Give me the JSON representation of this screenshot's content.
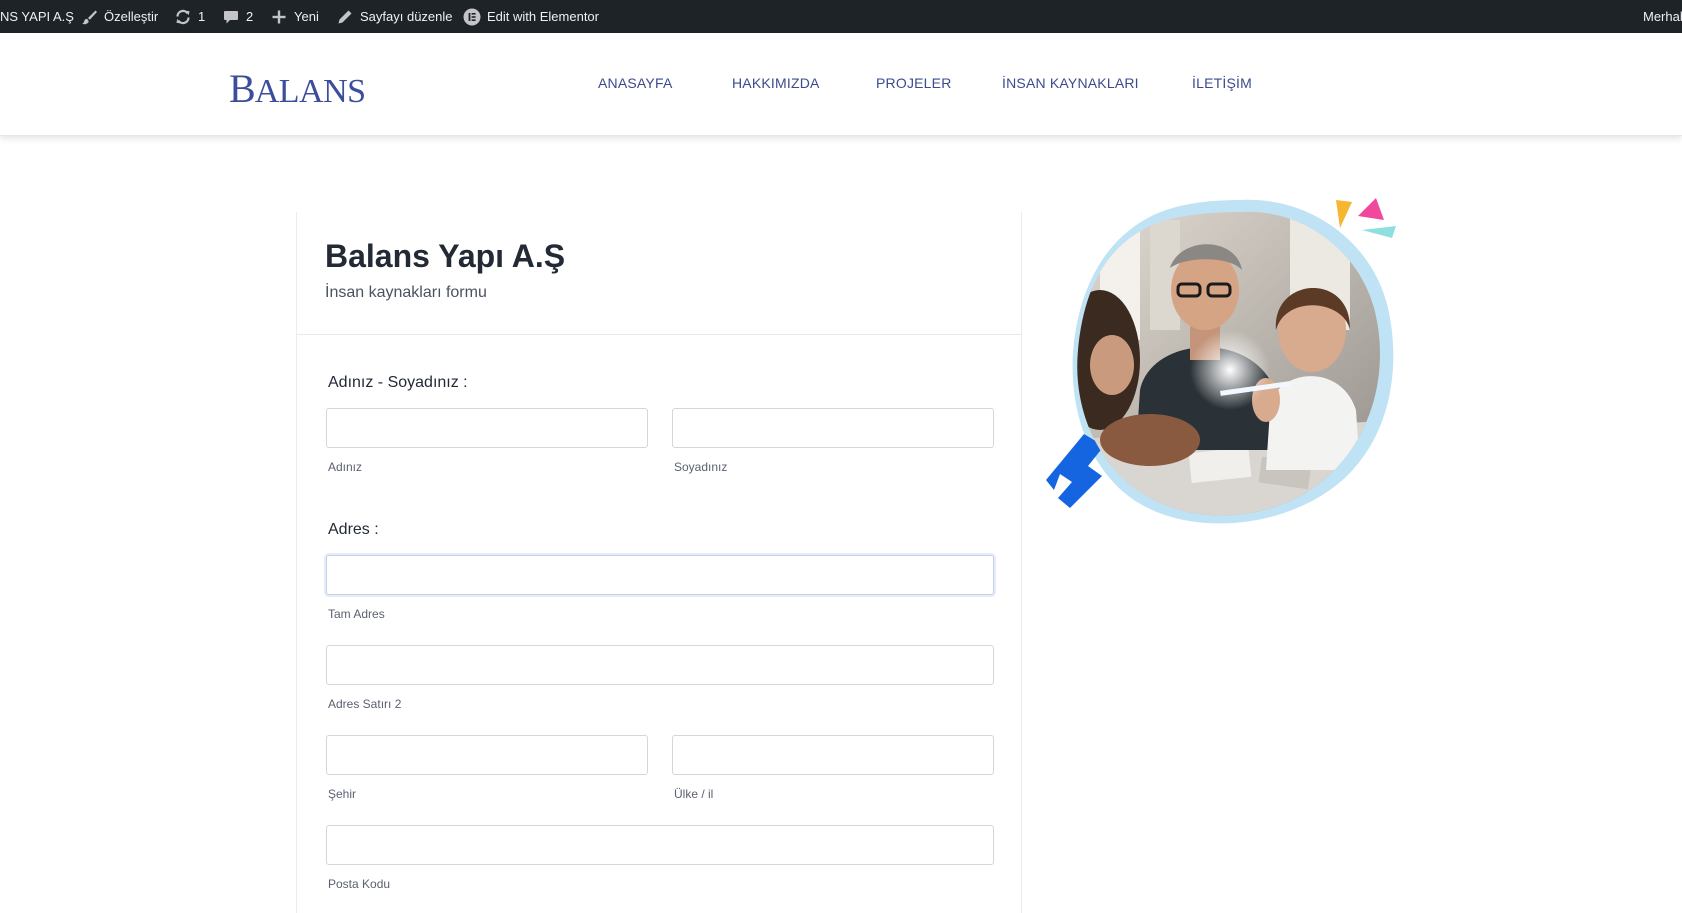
{
  "adminbar": {
    "site_name": "NS YAPI A.Ş",
    "customize": "Özelleştir",
    "updates_count": "1",
    "comments_count": "2",
    "new": "Yeni",
    "edit_page": "Sayfayı düzenle",
    "edit_elementor": "Edit with Elementor",
    "greeting": "Merhab"
  },
  "header": {
    "logo_initial": "B",
    "logo_rest": "ALANS",
    "nav": [
      {
        "label": "ANASAYFA"
      },
      {
        "label": "HAKKIMIZDA"
      },
      {
        "label": "PROJELER"
      },
      {
        "label": "İNSAN KAYNAKLARI"
      },
      {
        "label": "İLETİŞİM"
      }
    ]
  },
  "form": {
    "title": "Balans Yapı A.Ş",
    "subtitle": "İnsan kaynakları formu",
    "name_section": {
      "label": "Adınız - Soyadınız :",
      "first_name": {
        "value": "",
        "sublabel": "Adınız"
      },
      "last_name": {
        "value": "",
        "sublabel": "Soyadınız"
      }
    },
    "address_section": {
      "label": "Adres :",
      "full_address": {
        "value": "",
        "sublabel": "Tam Adres"
      },
      "address_line2": {
        "value": "",
        "sublabel": "Adres Satırı 2"
      },
      "city": {
        "value": "",
        "sublabel": "Şehir"
      },
      "country": {
        "value": "",
        "sublabel": "Ülke / il"
      },
      "postal_code": {
        "value": "",
        "sublabel": "Posta Kodu"
      }
    }
  },
  "icons": {
    "customize": "brush-icon",
    "updates": "refresh-icon",
    "comments": "comment-icon",
    "new": "plus-icon",
    "edit": "pencil-icon",
    "elementor": "elementor-icon"
  },
  "colors": {
    "adminbar_bg": "#1d2327",
    "brand_blue": "#3b4d9c",
    "nav_text": "#3d4a8f",
    "title_text": "#232a36",
    "blob_blue": "#bfe3f5",
    "accent_blue": "#1565e0",
    "accent_yellow": "#f6b632",
    "accent_pink": "#f0489a",
    "accent_teal": "#8fdfe0"
  }
}
